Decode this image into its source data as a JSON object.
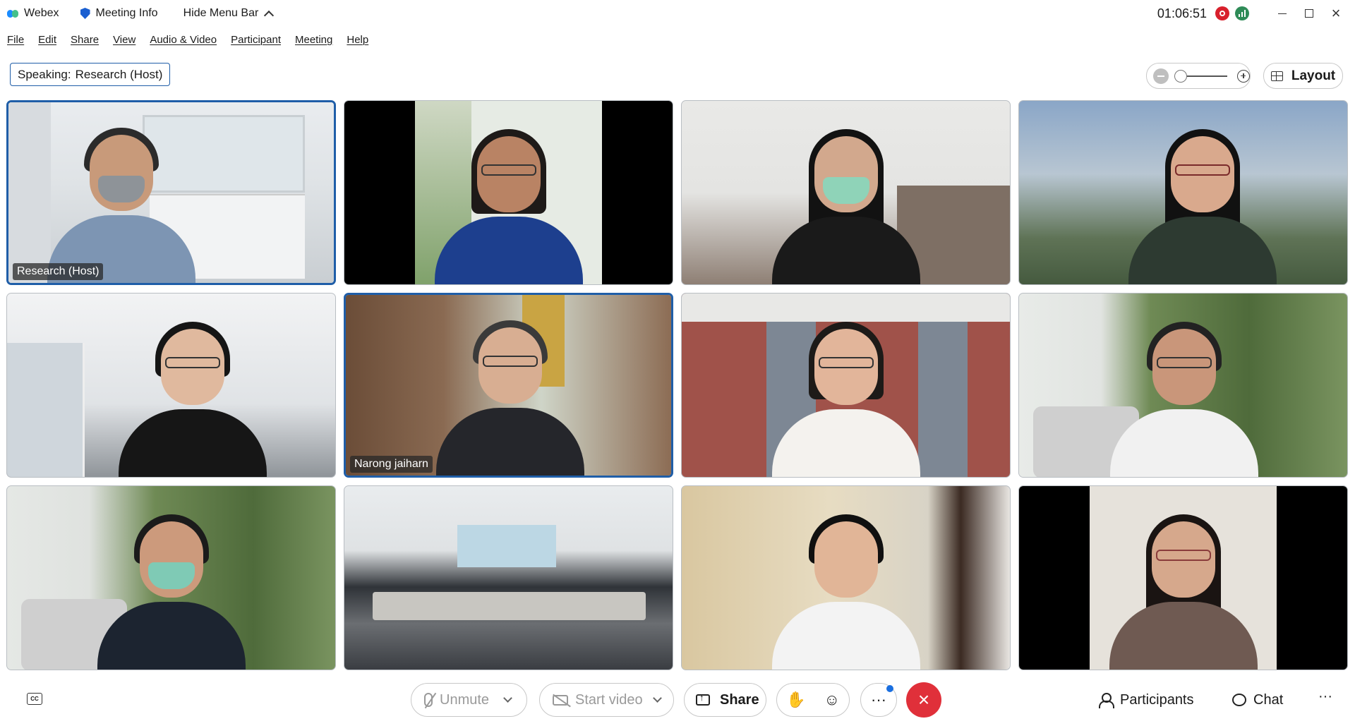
{
  "titlebar": {
    "app_name": "Webex",
    "meeting_info": "Meeting Info",
    "hide_menu_bar": "Hide Menu Bar",
    "clock": "01:06:51"
  },
  "menu": [
    "File",
    "Edit",
    "Share",
    "View",
    "Audio & Video",
    "Participant",
    "Meeting",
    "Help"
  ],
  "speaking": {
    "label": "Speaking:",
    "name": "Research (Host)"
  },
  "layout_label": "Layout",
  "tiles": [
    {
      "name": "Research (Host)"
    },
    {
      "name": ""
    },
    {
      "name": ""
    },
    {
      "name": ""
    },
    {
      "name": ""
    },
    {
      "name": "Narong jaiharn"
    },
    {
      "name": ""
    },
    {
      "name": ""
    },
    {
      "name": ""
    },
    {
      "name": ""
    },
    {
      "name": ""
    },
    {
      "name": ""
    }
  ],
  "toolbar": {
    "unmute": "Unmute",
    "start_video": "Start video",
    "share": "Share",
    "participants": "Participants",
    "chat": "Chat"
  },
  "colors": {
    "accent": "#1f5ea8",
    "end_call": "#e0303a",
    "record": "#d8202c"
  }
}
